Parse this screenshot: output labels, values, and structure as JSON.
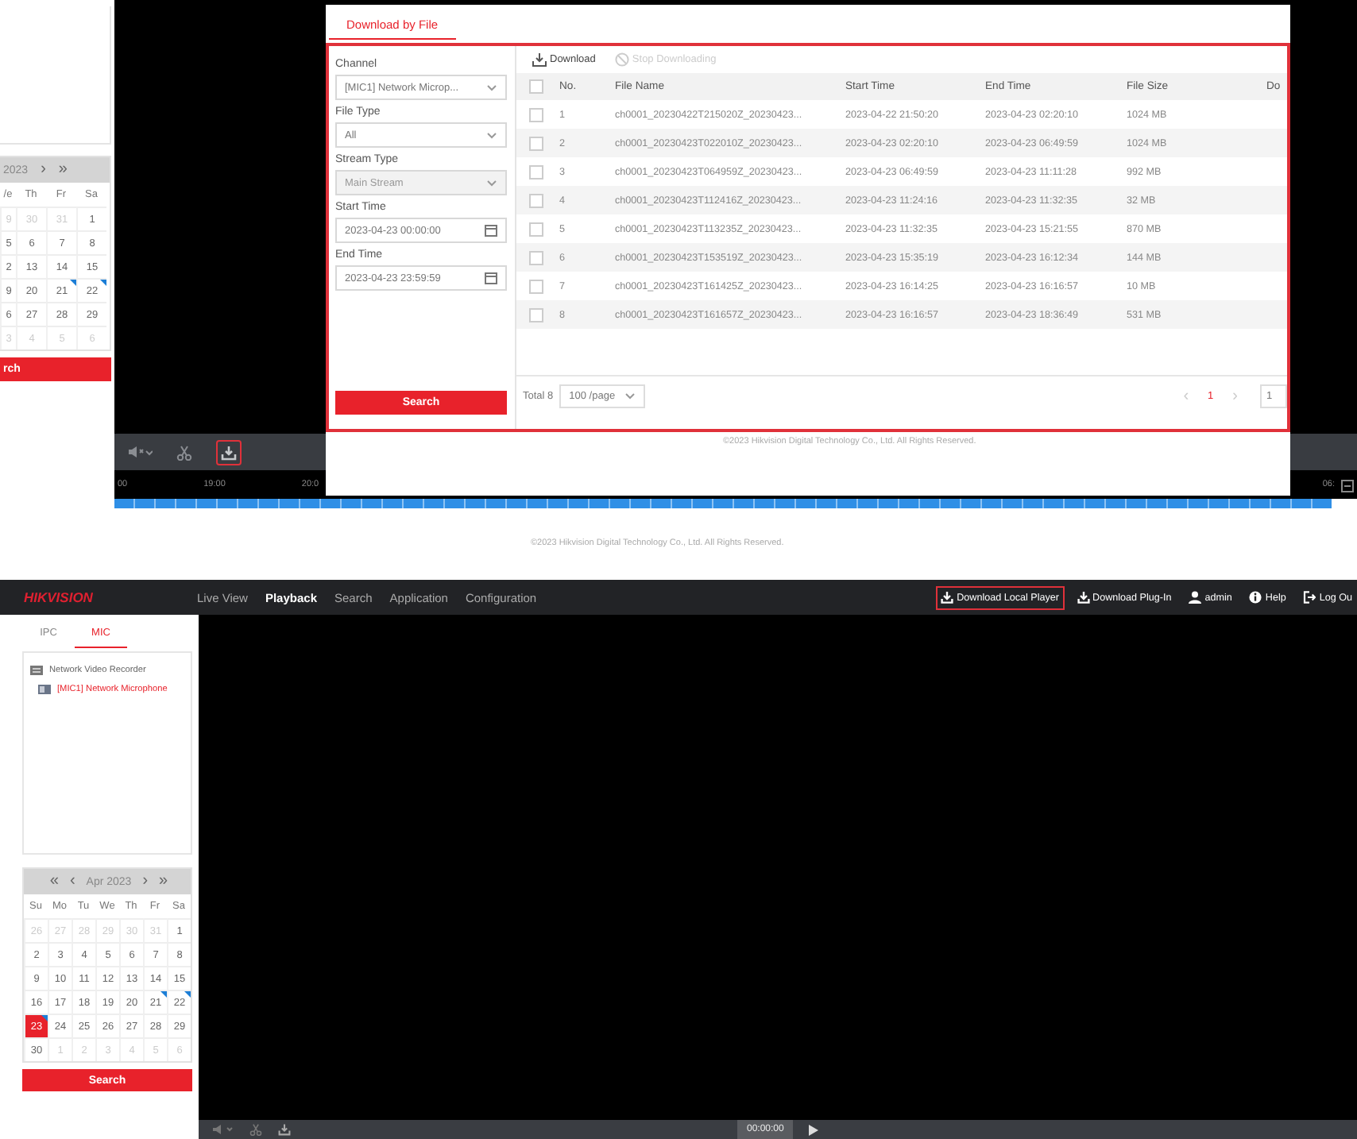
{
  "top_view": {
    "calendar": {
      "title": "2023",
      "next_month": "›",
      "next_year": "»",
      "weekdays": [
        "/e",
        "Th",
        "Fr",
        "Sa"
      ],
      "weeks": [
        [
          {
            "day": "9",
            "muted": true,
            "marked": false,
            "selected": false
          },
          {
            "day": "30",
            "muted": true,
            "marked": false,
            "selected": false
          },
          {
            "day": "31",
            "muted": true,
            "marked": false,
            "selected": false
          },
          {
            "day": "1",
            "muted": false,
            "marked": false,
            "selected": false
          }
        ],
        [
          {
            "day": "5",
            "muted": false,
            "marked": false,
            "selected": false
          },
          {
            "day": "6",
            "muted": false,
            "marked": false,
            "selected": false
          },
          {
            "day": "7",
            "muted": false,
            "marked": false,
            "selected": false
          },
          {
            "day": "8",
            "muted": false,
            "marked": false,
            "selected": false
          }
        ],
        [
          {
            "day": "2",
            "muted": false,
            "marked": false,
            "selected": false
          },
          {
            "day": "13",
            "muted": false,
            "marked": false,
            "selected": false
          },
          {
            "day": "14",
            "muted": false,
            "marked": false,
            "selected": false
          },
          {
            "day": "15",
            "muted": false,
            "marked": false,
            "selected": false
          }
        ],
        [
          {
            "day": "9",
            "muted": false,
            "marked": false,
            "selected": false
          },
          {
            "day": "20",
            "muted": false,
            "marked": false,
            "selected": false
          },
          {
            "day": "21",
            "muted": false,
            "marked": true,
            "selected": false
          },
          {
            "day": "22",
            "muted": false,
            "marked": true,
            "selected": false
          }
        ],
        [
          {
            "day": "6",
            "muted": false,
            "marked": false,
            "selected": false
          },
          {
            "day": "27",
            "muted": false,
            "marked": false,
            "selected": false
          },
          {
            "day": "28",
            "muted": false,
            "marked": false,
            "selected": false
          },
          {
            "day": "29",
            "muted": false,
            "marked": false,
            "selected": false
          }
        ],
        [
          {
            "day": "3",
            "muted": true,
            "marked": false,
            "selected": false
          },
          {
            "day": "4",
            "muted": true,
            "marked": false,
            "selected": false
          },
          {
            "day": "5",
            "muted": true,
            "marked": false,
            "selected": false
          },
          {
            "day": "6",
            "muted": true,
            "marked": false,
            "selected": false
          }
        ]
      ]
    },
    "search_button": "rch",
    "toolbar": [
      {
        "kind": "volume",
        "highlighted": false
      },
      {
        "kind": "cut",
        "highlighted": false
      },
      {
        "kind": "download",
        "highlighted": true
      }
    ],
    "timeline": {
      "labels": [
        "00",
        "19:00",
        "20:0"
      ],
      "right_label": "06:"
    },
    "dialog": {
      "tab": {
        "label": "Download by File",
        "selected": true
      },
      "highlighted": true,
      "form": [
        {
          "label": "Channel",
          "value": "[MIC1] Network Microp...",
          "kind": "select",
          "disabled": false
        },
        {
          "label": "File Type",
          "value": "All",
          "kind": "select",
          "disabled": false
        },
        {
          "label": "Stream Type",
          "value": "Main Stream",
          "kind": "select",
          "disabled": true
        },
        {
          "label": "Start Time",
          "value": "2023-04-23 00:00:00",
          "kind": "date",
          "disabled": false
        },
        {
          "label": "End Time",
          "value": "2023-04-23 23:59:59",
          "kind": "date",
          "disabled": false
        }
      ],
      "search_button": "Search",
      "actions": [
        {
          "label": "Download",
          "kind": "download",
          "disabled": false
        },
        {
          "label": "Stop Downloading",
          "kind": "stop",
          "disabled": true
        }
      ],
      "table": {
        "columns": [
          "No.",
          "File Name",
          "Start Time",
          "End Time",
          "File Size",
          "Do"
        ],
        "rows": [
          {
            "checked": false,
            "cells": [
              "1",
              "ch0001_20230422T215020Z_20230423...",
              "2023-04-22 21:50:20",
              "2023-04-23 02:20:10",
              "1024 MB"
            ]
          },
          {
            "checked": false,
            "cells": [
              "2",
              "ch0001_20230423T022010Z_20230423...",
              "2023-04-23 02:20:10",
              "2023-04-23 06:49:59",
              "1024 MB"
            ]
          },
          {
            "checked": false,
            "cells": [
              "3",
              "ch0001_20230423T064959Z_20230423...",
              "2023-04-23 06:49:59",
              "2023-04-23 11:11:28",
              "992 MB"
            ]
          },
          {
            "checked": false,
            "cells": [
              "4",
              "ch0001_20230423T112416Z_20230423...",
              "2023-04-23 11:24:16",
              "2023-04-23 11:32:35",
              "32 MB"
            ]
          },
          {
            "checked": false,
            "cells": [
              "5",
              "ch0001_20230423T113235Z_20230423...",
              "2023-04-23 11:32:35",
              "2023-04-23 15:21:55",
              "870 MB"
            ]
          },
          {
            "checked": false,
            "cells": [
              "6",
              "ch0001_20230423T153519Z_20230423...",
              "2023-04-23 15:35:19",
              "2023-04-23 16:12:34",
              "144 MB"
            ]
          },
          {
            "checked": false,
            "cells": [
              "7",
              "ch0001_20230423T161425Z_20230423...",
              "2023-04-23 16:14:25",
              "2023-04-23 16:16:57",
              "10 MB"
            ]
          },
          {
            "checked": false,
            "cells": [
              "8",
              "ch0001_20230423T161657Z_20230423...",
              "2023-04-23 16:16:57",
              "2023-04-23 18:36:49",
              "531 MB"
            ]
          }
        ]
      },
      "footer": {
        "total": "Total 8",
        "page_size": "100 /page",
        "prev": "‹",
        "pages": [
          {
            "label": "1",
            "selected": true
          }
        ],
        "next": "›",
        "jump": "1"
      },
      "copyright": "©2023 Hikvision Digital Technology Co., Ltd. All Rights Reserved."
    },
    "copyright": "©2023 Hikvision Digital Technology Co., Ltd. All Rights Reserved."
  },
  "bottom_view": {
    "header": {
      "logo": "HIKVISION",
      "nav": [
        {
          "label": "Live View",
          "selected": false
        },
        {
          "label": "Playback",
          "selected": true
        },
        {
          "label": "Search",
          "selected": false
        },
        {
          "label": "Application",
          "selected": false
        },
        {
          "label": "Configuration",
          "selected": false
        }
      ],
      "actions": [
        {
          "label": "Download Local Player",
          "kind": "download",
          "highlighted": true
        },
        {
          "label": "Download Plug-In",
          "kind": "download",
          "highlighted": false
        },
        {
          "label": "admin",
          "kind": "user",
          "highlighted": false
        },
        {
          "label": "Help",
          "kind": "help",
          "highlighted": false
        },
        {
          "label": "Log Ou",
          "kind": "logout",
          "highlighted": false
        }
      ]
    },
    "sidebar": {
      "tabs": [
        {
          "label": "IPC",
          "selected": false
        },
        {
          "label": "MIC",
          "selected": true
        }
      ],
      "tree": [
        {
          "label": "Network Video Recorder",
          "selected": false,
          "children": [
            {
              "label": "[MIC1] Network Microphone",
              "selected": true
            }
          ]
        }
      ],
      "calendar": {
        "prev_year": "«",
        "prev_month": "‹",
        "title": "Apr 2023",
        "next_month": "›",
        "next_year": "»",
        "weekdays": [
          "Su",
          "Mo",
          "Tu",
          "We",
          "Th",
          "Fr",
          "Sa"
        ],
        "weeks": [
          [
            {
              "day": "26",
              "muted": true,
              "marked": false,
              "selected": false
            },
            {
              "day": "27",
              "muted": true,
              "marked": false,
              "selected": false
            },
            {
              "day": "28",
              "muted": true,
              "marked": false,
              "selected": false
            },
            {
              "day": "29",
              "muted": true,
              "marked": false,
              "selected": false
            },
            {
              "day": "30",
              "muted": true,
              "marked": false,
              "selected": false
            },
            {
              "day": "31",
              "muted": true,
              "marked": false,
              "selected": false
            },
            {
              "day": "1",
              "muted": false,
              "marked": false,
              "selected": false
            }
          ],
          [
            {
              "day": "2",
              "muted": false,
              "marked": false,
              "selected": false
            },
            {
              "day": "3",
              "muted": false,
              "marked": false,
              "selected": false
            },
            {
              "day": "4",
              "muted": false,
              "marked": false,
              "selected": false
            },
            {
              "day": "5",
              "muted": false,
              "marked": false,
              "selected": false
            },
            {
              "day": "6",
              "muted": false,
              "marked": false,
              "selected": false
            },
            {
              "day": "7",
              "muted": false,
              "marked": false,
              "selected": false
            },
            {
              "day": "8",
              "muted": false,
              "marked": false,
              "selected": false
            }
          ],
          [
            {
              "day": "9",
              "muted": false,
              "marked": false,
              "selected": false
            },
            {
              "day": "10",
              "muted": false,
              "marked": false,
              "selected": false
            },
            {
              "day": "11",
              "muted": false,
              "marked": false,
              "selected": false
            },
            {
              "day": "12",
              "muted": false,
              "marked": false,
              "selected": false
            },
            {
              "day": "13",
              "muted": false,
              "marked": false,
              "selected": false
            },
            {
              "day": "14",
              "muted": false,
              "marked": false,
              "selected": false
            },
            {
              "day": "15",
              "muted": false,
              "marked": false,
              "selected": false
            }
          ],
          [
            {
              "day": "16",
              "muted": false,
              "marked": false,
              "selected": false
            },
            {
              "day": "17",
              "muted": false,
              "marked": false,
              "selected": false
            },
            {
              "day": "18",
              "muted": false,
              "marked": false,
              "selected": false
            },
            {
              "day": "19",
              "muted": false,
              "marked": false,
              "selected": false
            },
            {
              "day": "20",
              "muted": false,
              "marked": false,
              "selected": false
            },
            {
              "day": "21",
              "muted": false,
              "marked": true,
              "selected": false
            },
            {
              "day": "22",
              "muted": false,
              "marked": true,
              "selected": false
            }
          ],
          [
            {
              "day": "23",
              "muted": false,
              "marked": true,
              "selected": true
            },
            {
              "day": "24",
              "muted": false,
              "marked": false,
              "selected": false
            },
            {
              "day": "25",
              "muted": false,
              "marked": false,
              "selected": false
            },
            {
              "day": "26",
              "muted": false,
              "marked": false,
              "selected": false
            },
            {
              "day": "27",
              "muted": false,
              "marked": false,
              "selected": false
            },
            {
              "day": "28",
              "muted": false,
              "marked": false,
              "selected": false
            },
            {
              "day": "29",
              "muted": false,
              "marked": false,
              "selected": false
            }
          ],
          [
            {
              "day": "30",
              "muted": false,
              "marked": false,
              "selected": false
            },
            {
              "day": "1",
              "muted": true,
              "marked": false,
              "selected": false
            },
            {
              "day": "2",
              "muted": true,
              "marked": false,
              "selected": false
            },
            {
              "day": "3",
              "muted": true,
              "marked": false,
              "selected": false
            },
            {
              "day": "4",
              "muted": true,
              "marked": false,
              "selected": false
            },
            {
              "day": "5",
              "muted": true,
              "marked": false,
              "selected": false
            },
            {
              "day": "6",
              "muted": true,
              "marked": false,
              "selected": false
            }
          ]
        ]
      },
      "search_button": "Search"
    },
    "player": {
      "time": "00:00:00"
    }
  }
}
